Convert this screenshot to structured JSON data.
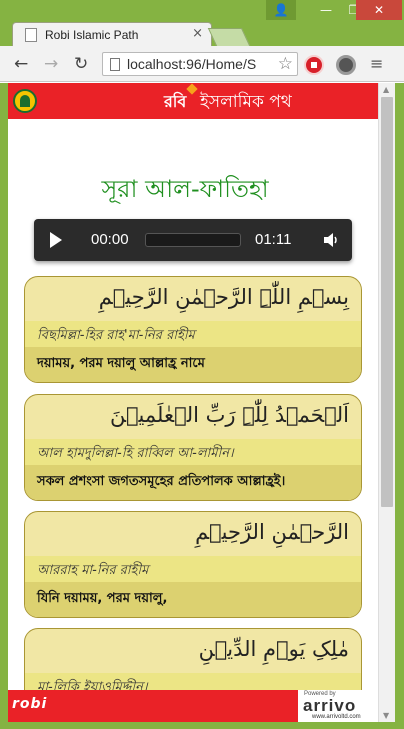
{
  "browser": {
    "tab_title": "Robi Islamic Path",
    "tab_close": "×",
    "url": "localhost:96/Home/S",
    "window_controls": {
      "user": "👤",
      "minimize": "—",
      "maximize": "❐",
      "close": "✕"
    },
    "nav": {
      "back": "←",
      "forward": "→",
      "reload": "↻"
    },
    "star": "☆",
    "menu": "≡"
  },
  "app": {
    "brand": "রবি",
    "title": "ইসলামিক পথ",
    "accent_color": "#ea2227"
  },
  "surah": {
    "title": "সূরা আল-ফাতিহা"
  },
  "audio": {
    "current_time": "00:00",
    "duration": "01:11",
    "progress": 0
  },
  "verses": [
    {
      "arabic": "بِسۡمِ اللّٰہِ الرَّحۡمٰنِ الرَّحِیۡمِ",
      "transliteration": "বিছমিল্লা-হির রাহ'মা-নির রাহীম",
      "meaning": "দয়াময়, পরম দয়ালু আল্লাহ্র নামে"
    },
    {
      "arabic": "اَلۡحَمۡدُ لِلّٰہِ رَبِّ الۡعٰلَمِیۡنَ",
      "transliteration": "আল হামদুলিল্লা-হি রাব্বিল আ-লামীন।",
      "meaning": "সকল প্রশংসা জগতসমূহের প্রতিপালক আল্লাহ্রই।"
    },
    {
      "arabic": "الرَّحۡمٰنِ الرَّحِیۡمِ",
      "transliteration": "আররাহ মা-নির রাহীম",
      "meaning": "যিনি দয়াময়, পরম দয়ালু,"
    },
    {
      "arabic": "مٰلِکِ یَوۡمِ الدِّیۡنِ",
      "transliteration": "মা-লিকি ইয়াওমিদ্দীন।",
      "meaning": ""
    }
  ],
  "footer": {
    "logo": "robi",
    "powered_by": "Powered by",
    "brand": "arrivo",
    "site": "www.arrivoltd.com"
  }
}
